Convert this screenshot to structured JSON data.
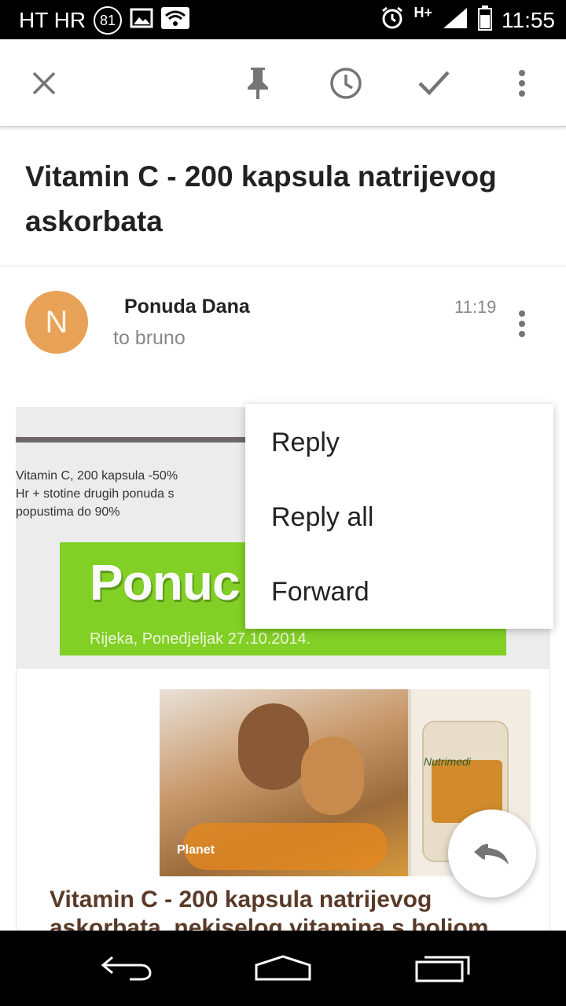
{
  "status_bar": {
    "carrier": "HT HR",
    "badge": "81",
    "network": "H+",
    "time": "11:55"
  },
  "toolbar": {
    "icons": [
      "close-icon",
      "pin-icon",
      "snooze-clock-icon",
      "done-check-icon",
      "more-vert-icon"
    ]
  },
  "email": {
    "subject": "Vitamin C - 200 kapsula natrijevog askorbata",
    "sender": {
      "initial": "N",
      "name": "Ponuda Dana",
      "recipient": "to bruno",
      "time": "11:19",
      "avatar_color": "#e8a257"
    },
    "body": {
      "preheader_lines": [
        "Vitamin C, 200 kapsula -50%",
        "Hr + stotine drugih ponuda s",
        "popustima do 90%"
      ],
      "banner_logo": "Ponuc",
      "banner_subtitle": "Rijeka, Ponedjeljak 27.10.2014.",
      "image_brand": "Nutrimedi",
      "image_watermark": "Planet",
      "article_title_lines": [
        "Vitamin C - 200 kapsula natrijevog",
        "askorbata, nekiselog vitamina s boljom"
      ]
    }
  },
  "popup_menu": {
    "items": [
      "Reply",
      "Reply all",
      "Forward"
    ]
  },
  "fab": {
    "icon": "reply-all-icon"
  },
  "nav_bar": {
    "icons": [
      "back-icon",
      "home-icon",
      "recents-icon"
    ]
  },
  "colors": {
    "banner_green": "#82cf26",
    "toolbar_icon": "#757575",
    "title_brown": "#5a3a28"
  }
}
